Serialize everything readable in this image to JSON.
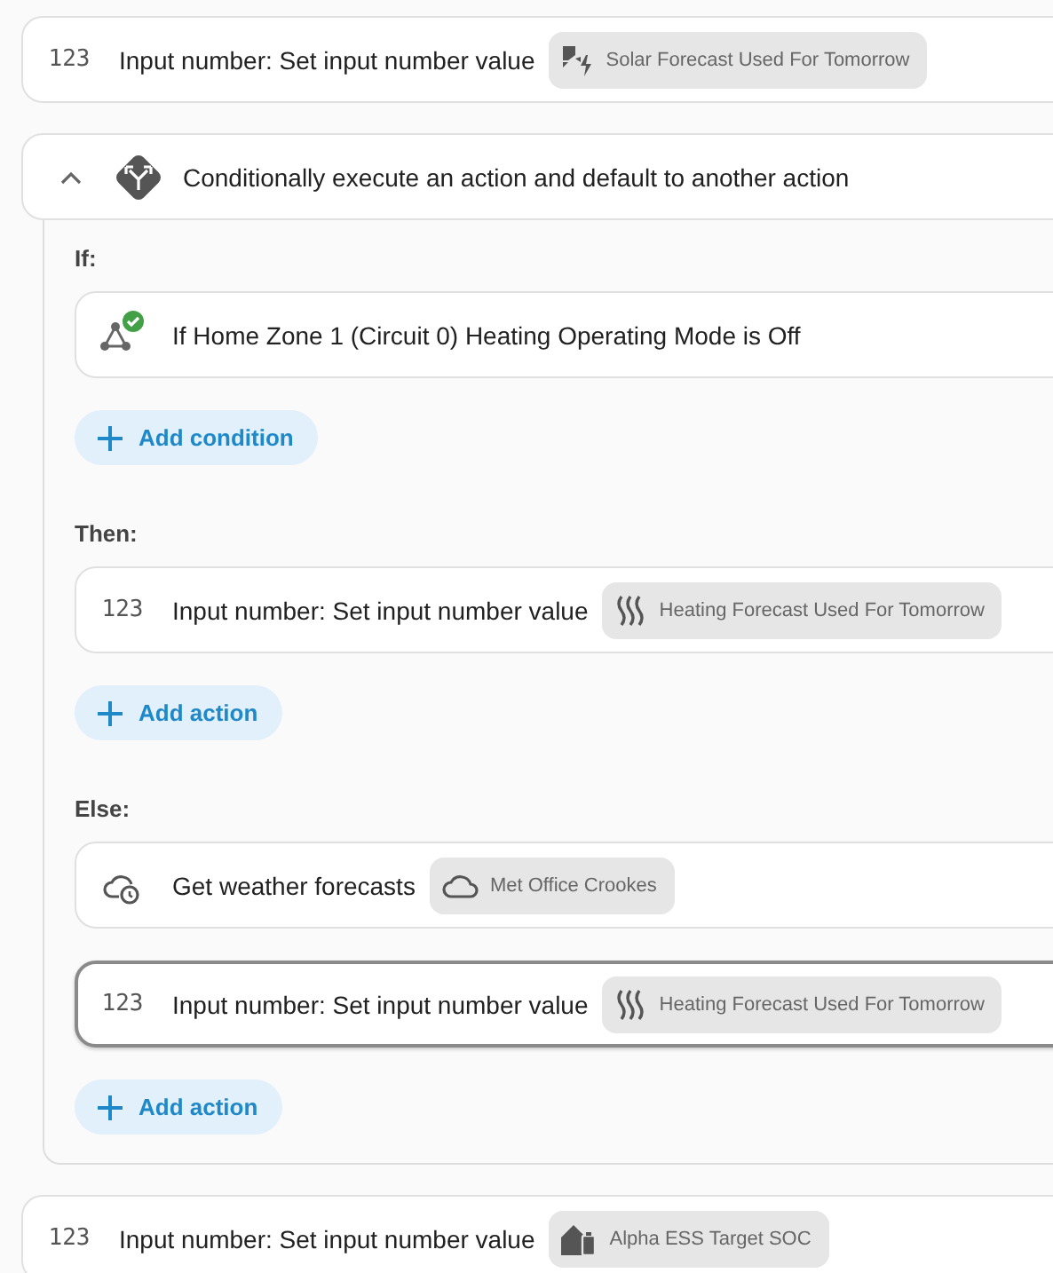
{
  "actions": [
    {
      "kind": "number",
      "icon_label": "123",
      "title": "Input number: Set input number value",
      "selected": false,
      "chip": {
        "kind": "solar",
        "label": "Solar Forecast Used For Tomorrow"
      }
    },
    {
      "kind": "choose",
      "expanded": true,
      "title": "Conditionally execute an action and default to another action",
      "sections": [
        {
          "label": "If:",
          "items": [
            {
              "kind": "condition",
              "title": "If Home Zone 1 (Circuit 0) Heating Operating Mode is Off",
              "selected": false
            }
          ],
          "add_button": "Add condition"
        },
        {
          "label": "Then:",
          "items": [
            {
              "kind": "number",
              "icon_label": "123",
              "title": "Input number: Set input number value",
              "selected": false,
              "chip": {
                "kind": "heat",
                "label": "Heating Forecast Used For Tomorrow"
              }
            }
          ],
          "add_button": "Add action"
        },
        {
          "label": "Else:",
          "items": [
            {
              "kind": "weather",
              "title": "Get weather forecasts",
              "selected": false,
              "chip": {
                "kind": "cloud",
                "label": "Met Office Crookes"
              }
            },
            {
              "kind": "number",
              "icon_label": "123",
              "title": "Input number: Set input number value",
              "selected": true,
              "chip": {
                "kind": "heat",
                "label": "Heating Forecast Used For Tomorrow"
              }
            }
          ],
          "add_button": "Add action"
        }
      ]
    },
    {
      "kind": "number",
      "icon_label": "123",
      "title": "Input number: Set input number value",
      "selected": false,
      "chip": {
        "kind": "house-battery",
        "label": "Alpha ESS Target SOC"
      }
    }
  ]
}
